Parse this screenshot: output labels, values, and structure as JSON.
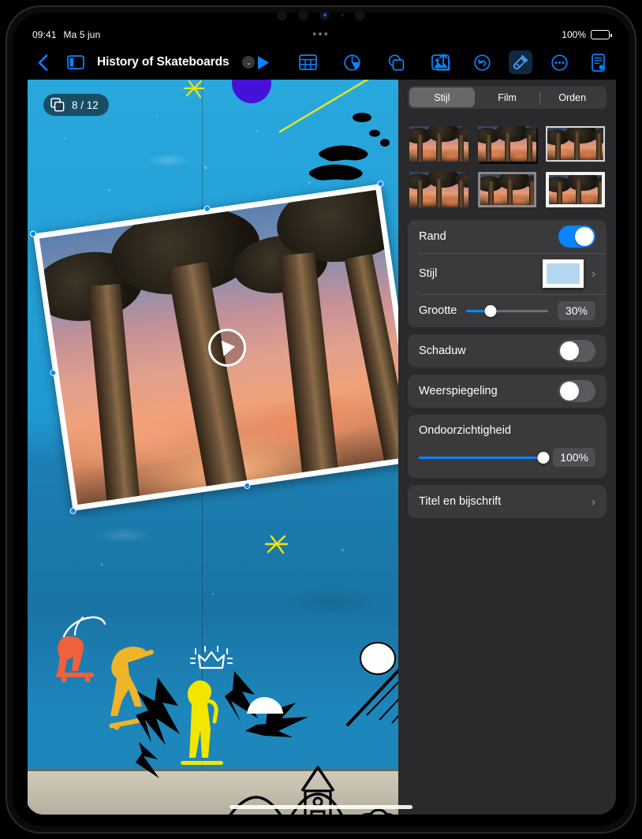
{
  "status_bar": {
    "time": "09:41",
    "date": "Ma 5 jun",
    "multitask_dots": "•••",
    "battery_percent": "100%"
  },
  "toolbar": {
    "back_icon": "chevron-left-icon",
    "sidebar_icon": "sidebar-toggle-icon",
    "document_title": "History of Skateboards",
    "title_chevron": "⌄",
    "play_icon": "play-icon",
    "table_icon": "table-icon",
    "chart_icon": "chart-icon",
    "shape_icon": "shape-icon",
    "media_icon": "media-icon",
    "share_icon": "share-icon",
    "undo_icon": "undo-icon",
    "format_icon": "format-brush-icon",
    "more_icon": "more-icon",
    "notes_icon": "document-notes-icon"
  },
  "canvas": {
    "slide_badge": {
      "icon": "slides-icon",
      "counter": "8 / 12"
    },
    "media": {
      "play_overlay": "play-icon",
      "alt": "Baobab trees at sunset video"
    }
  },
  "inspector": {
    "tabs": [
      {
        "label": "Stijl",
        "selected": true
      },
      {
        "label": "Film",
        "selected": false
      },
      {
        "label": "Orden",
        "selected": false
      }
    ],
    "style_thumbnails": [
      {
        "name": "style-plain",
        "selected": false
      },
      {
        "name": "style-shadow",
        "selected": false
      },
      {
        "name": "style-thin-light-border",
        "selected": false
      },
      {
        "name": "style-no-border",
        "selected": false
      },
      {
        "name": "style-gray-border",
        "selected": false
      },
      {
        "name": "style-white-border",
        "selected": true
      }
    ],
    "border": {
      "label": "Rand",
      "enabled": true
    },
    "border_style": {
      "label": "Stijl",
      "swatch_color": "#b4d7ef",
      "frame_color": "#ffffff",
      "chevron": "›"
    },
    "border_size": {
      "label": "Grootte",
      "value": "30%",
      "percent": 30
    },
    "shadow": {
      "label": "Schaduw",
      "enabled": false
    },
    "reflection": {
      "label": "Weerspiegeling",
      "enabled": false
    },
    "opacity": {
      "label": "Ondoorzichtigheid",
      "value": "100%",
      "percent": 100
    },
    "title_caption": {
      "label": "Titel en bijschrift",
      "chevron": "›"
    }
  },
  "colors": {
    "accent": "#0a84ff",
    "panel_bg": "#2a2a2c",
    "group_bg": "#3a3a3c",
    "wall": "#1d9ed6",
    "graffiti_yellow": "#f2e500",
    "graffiti_gold": "#f0b429",
    "graffiti_orange": "#f0603a"
  }
}
